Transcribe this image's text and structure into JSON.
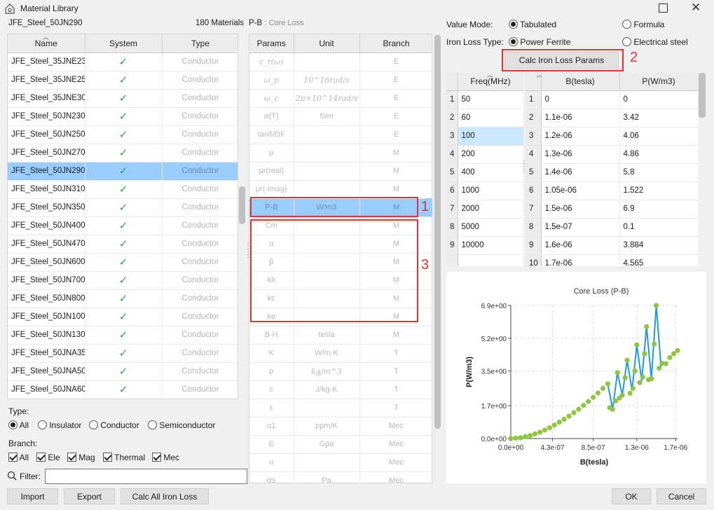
{
  "window": {
    "title": "Material Library",
    "icon": "library-house-icon",
    "maximize_icon": "maximize-icon",
    "close_icon": "close-icon",
    "close_glyph": "✕"
  },
  "header": {
    "selected_material": "JFE_Steel_50JN290",
    "material_count": "180 Materials",
    "param_title": "P-B",
    "param_subtitle": ": Core Loss"
  },
  "materials": {
    "columns": [
      "Name",
      "System",
      "Type"
    ],
    "check_glyph": "✓",
    "rows": [
      {
        "name": "JFE_Steel_35JNE230",
        "system": true,
        "type": "Conductor"
      },
      {
        "name": "JFE_Steel_35JNE250",
        "system": true,
        "type": "Conductor"
      },
      {
        "name": "JFE_Steel_35JNE300",
        "system": true,
        "type": "Conductor"
      },
      {
        "name": "JFE_Steel_50JN230",
        "system": true,
        "type": "Conductor"
      },
      {
        "name": "JFE_Steel_50JN250",
        "system": true,
        "type": "Conductor"
      },
      {
        "name": "JFE_Steel_50JN270",
        "system": true,
        "type": "Conductor"
      },
      {
        "name": "JFE_Steel_50JN290",
        "system": true,
        "type": "Conductor",
        "selected": true
      },
      {
        "name": "JFE_Steel_50JN310",
        "system": true,
        "type": "Conductor"
      },
      {
        "name": "JFE_Steel_50JN350",
        "system": true,
        "type": "Conductor"
      },
      {
        "name": "JFE_Steel_50JN400",
        "system": true,
        "type": "Conductor"
      },
      {
        "name": "JFE_Steel_50JN470",
        "system": true,
        "type": "Conductor"
      },
      {
        "name": "JFE_Steel_50JN600",
        "system": true,
        "type": "Conductor"
      },
      {
        "name": "JFE_Steel_50JN700",
        "system": true,
        "type": "Conductor"
      },
      {
        "name": "JFE_Steel_50JN800",
        "system": true,
        "type": "Conductor"
      },
      {
        "name": "JFE_Steel_50JN1000",
        "system": true,
        "type": "Conductor"
      },
      {
        "name": "JFE_Steel_50JN1300",
        "system": true,
        "type": "Conductor"
      },
      {
        "name": "JFE_Steel_50JNA350",
        "system": true,
        "type": "Conductor"
      },
      {
        "name": "JFE_Steel_50JNA500",
        "system": true,
        "type": "Conductor"
      },
      {
        "name": "JFE_Steel_50JNA600",
        "system": true,
        "type": "Conductor"
      }
    ]
  },
  "params": {
    "columns": [
      "Params",
      "Unit",
      "Branch"
    ],
    "rows": [
      {
        "param": "ε_r(ω)",
        "unit": "",
        "branch": "E",
        "italic": true
      },
      {
        "param": "ω_p",
        "unit": "10^16rad/s",
        "branch": "E",
        "italic": true
      },
      {
        "param": "ω_c",
        "unit": "2π×10^14rad/s",
        "branch": "E",
        "italic": true
      },
      {
        "param": "σ(T)",
        "unit": "S/m",
        "branch": "E"
      },
      {
        "param": "tanδ/DF",
        "unit": "",
        "branch": "E"
      },
      {
        "param": "μ",
        "unit": "",
        "branch": "M"
      },
      {
        "param": "μr(real)",
        "unit": "",
        "branch": "M"
      },
      {
        "param": "μr(-imag)",
        "unit": "",
        "branch": "M"
      },
      {
        "param": "P-B",
        "unit": "W/m3",
        "branch": "M",
        "selected": true
      },
      {
        "param": "Cm",
        "unit": "",
        "branch": "M"
      },
      {
        "param": "α",
        "unit": "",
        "branch": "M"
      },
      {
        "param": "β",
        "unit": "",
        "branch": "M"
      },
      {
        "param": "kh",
        "unit": "",
        "branch": "M"
      },
      {
        "param": "kc",
        "unit": "",
        "branch": "M"
      },
      {
        "param": "ke",
        "unit": "",
        "branch": "M"
      },
      {
        "param": "B-H",
        "unit": "tesla",
        "branch": "M"
      },
      {
        "param": "K",
        "unit": "W/m·K",
        "branch": "T"
      },
      {
        "param": "ρ",
        "unit": "kg/m^3",
        "branch": "T",
        "italic_unit": true
      },
      {
        "param": "c",
        "unit": "J/kg·K",
        "branch": "T"
      },
      {
        "param": "ε",
        "unit": "",
        "branch": "T"
      },
      {
        "param": "α1",
        "unit": "ppm/K",
        "branch": "Mec"
      },
      {
        "param": "E",
        "unit": "Gpa",
        "branch": "Mec"
      },
      {
        "param": "υ",
        "unit": "",
        "branch": "Mec"
      },
      {
        "param": "σs",
        "unit": "Pa",
        "branch": "Mec"
      }
    ]
  },
  "annotations": {
    "n1": "1",
    "n2": "2",
    "n3": "3"
  },
  "value_mode": {
    "label": "Value Mode:",
    "options": [
      {
        "label": "Tabulated",
        "checked": true
      },
      {
        "label": "Formula",
        "checked": false
      }
    ]
  },
  "iron_loss": {
    "label": "Iron Loss Type:",
    "options": [
      {
        "label": "Power Ferrite",
        "checked": true
      },
      {
        "label": "Electrical steel",
        "checked": false
      }
    ]
  },
  "calc_btn": "Calc Iron Loss Params",
  "freq_table": {
    "header": "Freq(MHz)",
    "rows": [
      {
        "idx": "1",
        "val": "50"
      },
      {
        "idx": "2",
        "val": "60"
      },
      {
        "idx": "3",
        "val": "100",
        "selected": true
      },
      {
        "idx": "4",
        "val": "200"
      },
      {
        "idx": "5",
        "val": "400"
      },
      {
        "idx": "6",
        "val": "1000"
      },
      {
        "idx": "7",
        "val": "2000"
      },
      {
        "idx": "8",
        "val": "5000"
      },
      {
        "idx": "9",
        "val": "10000"
      }
    ]
  },
  "bp_table": {
    "headers": [
      "B(tesla)",
      "P(W/m3)"
    ],
    "rows": [
      {
        "idx": "1",
        "b": "0",
        "p": "0"
      },
      {
        "idx": "2",
        "b": "1.1e-06",
        "p": "3.42"
      },
      {
        "idx": "3",
        "b": "1.2e-06",
        "p": "4.06"
      },
      {
        "idx": "4",
        "b": "1.3e-06",
        "p": "4.86"
      },
      {
        "idx": "5",
        "b": "1.4e-06",
        "p": "5.8"
      },
      {
        "idx": "6",
        "b": "1.05e-06",
        "p": "1.522"
      },
      {
        "idx": "7",
        "b": "1.5e-06",
        "p": "6.9"
      },
      {
        "idx": "8",
        "b": "1.5e-07",
        "p": "0.1"
      },
      {
        "idx": "9",
        "b": "1.6e-06",
        "p": "3.884"
      },
      {
        "idx": "10",
        "b": "1.7e-06",
        "p": "4.565"
      }
    ]
  },
  "chart_data": {
    "type": "scatter",
    "title": "Core Loss (P-B)",
    "xlabel": "B(tesla)",
    "ylabel": "P(W/m3)",
    "xlim": [
      0,
      1.72e-06
    ],
    "ylim": [
      0,
      6.9
    ],
    "xticks": [
      "0.0e+00",
      "4.3e-07",
      "8.5e-07",
      "1.3e-06",
      "1.7e-06"
    ],
    "xtick_values": [
      0,
      4.3e-07,
      8.5e-07,
      1.3e-06,
      1.7e-06
    ],
    "yticks": [
      "0.0e+00",
      "1.7e+00",
      "3.5e+00",
      "5.2e+00",
      "6.9e+00"
    ],
    "ytick_values": [
      0,
      1.7,
      3.5,
      5.2,
      6.9
    ],
    "grid": true,
    "point_color": "#8dc63f",
    "line_color": "#1e9be0",
    "points": [
      [
        0.0,
        0.0
      ],
      [
        5e-08,
        0.02
      ],
      [
        1e-07,
        0.04
      ],
      [
        1.5e-07,
        0.1
      ],
      [
        2e-07,
        0.16
      ],
      [
        2.5e-07,
        0.24
      ],
      [
        3e-07,
        0.33
      ],
      [
        3.5e-07,
        0.44
      ],
      [
        4e-07,
        0.56
      ],
      [
        4.5e-07,
        0.7
      ],
      [
        5e-07,
        0.85
      ],
      [
        5.5e-07,
        1.0
      ],
      [
        6e-07,
        1.16
      ],
      [
        6.5e-07,
        1.34
      ],
      [
        7e-07,
        1.52
      ],
      [
        7.5e-07,
        1.72
      ],
      [
        8e-07,
        1.92
      ],
      [
        8.5e-07,
        2.14
      ],
      [
        9e-07,
        2.36
      ],
      [
        9.5e-07,
        2.6
      ],
      [
        1e-06,
        2.84
      ],
      [
        1.02e-06,
        1.6
      ],
      [
        1.05e-06,
        1.52
      ],
      [
        1.08e-06,
        1.95
      ],
      [
        1.1e-06,
        3.42
      ],
      [
        1.12e-06,
        2.1
      ],
      [
        1.15e-06,
        2.25
      ],
      [
        1.18e-06,
        3.15
      ],
      [
        1.2e-06,
        4.06
      ],
      [
        1.23e-06,
        2.35
      ],
      [
        1.26e-06,
        2.6
      ],
      [
        1.28e-06,
        3.5
      ],
      [
        1.3e-06,
        4.86
      ],
      [
        1.33e-06,
        2.9
      ],
      [
        1.36e-06,
        3.2
      ],
      [
        1.38e-06,
        4.4
      ],
      [
        1.4e-06,
        5.8
      ],
      [
        1.42e-06,
        3.05
      ],
      [
        1.45e-06,
        3.1
      ],
      [
        1.48e-06,
        4.9
      ],
      [
        1.5e-06,
        6.9
      ],
      [
        1.53e-06,
        3.65
      ],
      [
        1.56e-06,
        3.9
      ],
      [
        1.6e-06,
        3.884
      ],
      [
        1.64e-06,
        4.2
      ],
      [
        1.68e-06,
        4.4
      ],
      [
        1.72e-06,
        4.565
      ]
    ],
    "line_segment": [
      [
        1e-06,
        2.84
      ],
      [
        1.05e-06,
        1.52
      ],
      [
        1.1e-06,
        3.42
      ],
      [
        1.15e-06,
        2.25
      ],
      [
        1.2e-06,
        4.06
      ],
      [
        1.25e-06,
        2.5
      ],
      [
        1.3e-06,
        4.86
      ],
      [
        1.35e-06,
        3.0
      ],
      [
        1.4e-06,
        5.8
      ],
      [
        1.45e-06,
        3.1
      ],
      [
        1.5e-06,
        6.9
      ],
      [
        1.55e-06,
        3.7
      ]
    ]
  },
  "filters": {
    "type_label": "Type:",
    "type_options": [
      {
        "label": "All",
        "checked": true
      },
      {
        "label": "Insulator",
        "checked": false
      },
      {
        "label": "Conductor",
        "checked": false
      },
      {
        "label": "Semiconductor",
        "checked": false
      }
    ],
    "branch_label": "Branch:",
    "branch_options": [
      {
        "label": "All",
        "checked": true
      },
      {
        "label": "Ele",
        "checked": true
      },
      {
        "label": "Mag",
        "checked": true
      },
      {
        "label": "Thermal",
        "checked": true
      },
      {
        "label": "Mec",
        "checked": true
      }
    ],
    "filter_label": "Filter:",
    "filter_value": "",
    "filter_icon": "search-icon"
  },
  "footer": {
    "import": "Import",
    "export": "Export",
    "calc_all": "Calc All Iron Loss",
    "ok": "OK",
    "cancel": "Cancel"
  }
}
